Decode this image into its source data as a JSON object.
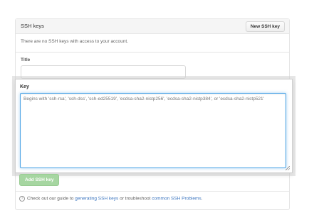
{
  "panel": {
    "title": "SSH keys",
    "new_key_label": "New SSH key",
    "empty_message": "There are no SSH keys with access to your account."
  },
  "form": {
    "title_label": "Title",
    "title_value": "",
    "key_label": "Key",
    "key_placeholder": "Begins with 'ssh-rsa', 'ssh-dss', 'ssh-ed25519', 'ecdsa-sha2-nistp256', 'ecdsa-sha2-nistp384', or 'ecdsa-sha2-nistp521'",
    "submit_label": "Add SSH key"
  },
  "footer": {
    "prefix": "Check out our guide to ",
    "link1": "generating SSH keys",
    "middle": " or troubleshoot ",
    "link2": "common SSH Problems",
    "suffix": ".",
    "icon": "question-circle-icon"
  },
  "colors": {
    "link": "#4078c0",
    "submit_disabled": "#a6d6a1",
    "focus_border": "#51a7e8"
  }
}
